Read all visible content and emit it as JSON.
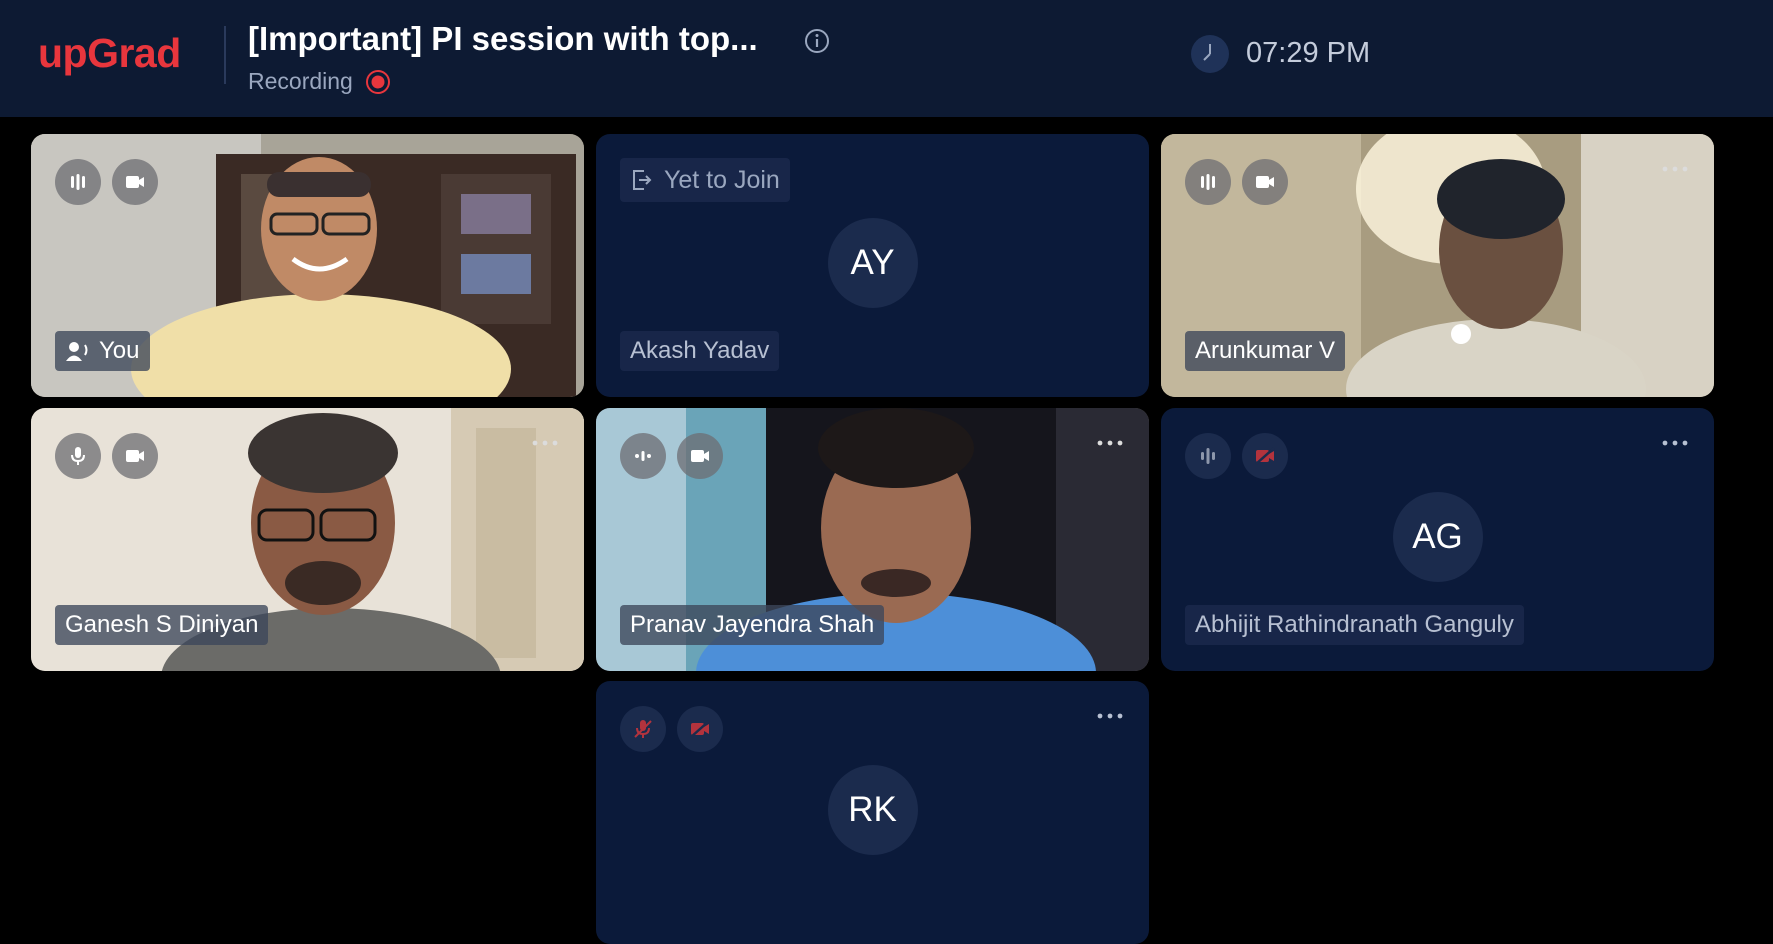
{
  "app": {
    "logo": "upGrad",
    "title": "[Important] PI session with top...",
    "recording_label": "Recording",
    "time": "07:29 PM"
  },
  "icons": {
    "info": "info-icon",
    "recording": "recording-dot-icon",
    "clock": "clock-icon",
    "more": "more-options-icon",
    "mic": "mic-icon",
    "audio_level": "audio-level-icon",
    "camera": "camera-icon",
    "camera_off": "camera-off-icon",
    "mic_off": "mic-off-icon",
    "speaker": "speaking-icon",
    "exit": "exit-icon"
  },
  "colors": {
    "brand": "#e8363d",
    "header_bg": "#0d1a33",
    "tile_bg": "#0b1a3a",
    "muted_red": "#b3333d"
  },
  "participants": [
    {
      "name": "You",
      "video": true,
      "speaking": true
    },
    {
      "name": "Akash Yadav",
      "initials": "AY",
      "status": "Yet to Join"
    },
    {
      "name": "Arunkumar V",
      "video": true
    },
    {
      "name": "Ganesh S Diniyan",
      "video": true
    },
    {
      "name": "Pranav Jayendra Shah",
      "video": true
    },
    {
      "name": "Abhijit Rathindranath Ganguly",
      "initials": "AG",
      "video": false
    },
    {
      "name": "",
      "initials": "RK",
      "video": false,
      "muted": true
    }
  ]
}
